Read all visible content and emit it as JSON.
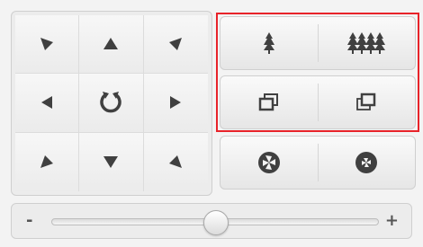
{
  "ptz_controls": {
    "direction_icons": [
      "arrow-up-left-icon",
      "arrow-up-icon",
      "arrow-up-right-icon",
      "arrow-left-icon",
      "auto-rotate-icon",
      "arrow-right-icon",
      "arrow-down-left-icon",
      "arrow-down-icon",
      "arrow-down-right-icon"
    ],
    "lens_icons": [
      "zoom-in-tree-icon",
      "zoom-out-trees-icon"
    ],
    "focus_icons": [
      "focus-near-icon",
      "focus-far-icon"
    ],
    "iris_icons": [
      "iris-open-icon",
      "iris-close-icon"
    ],
    "slider": {
      "minus_label": "-",
      "plus_label": "+",
      "speed_fraction": 0.5
    },
    "colors": {
      "icon": "#404040",
      "highlight_border": "#e8232a"
    }
  }
}
